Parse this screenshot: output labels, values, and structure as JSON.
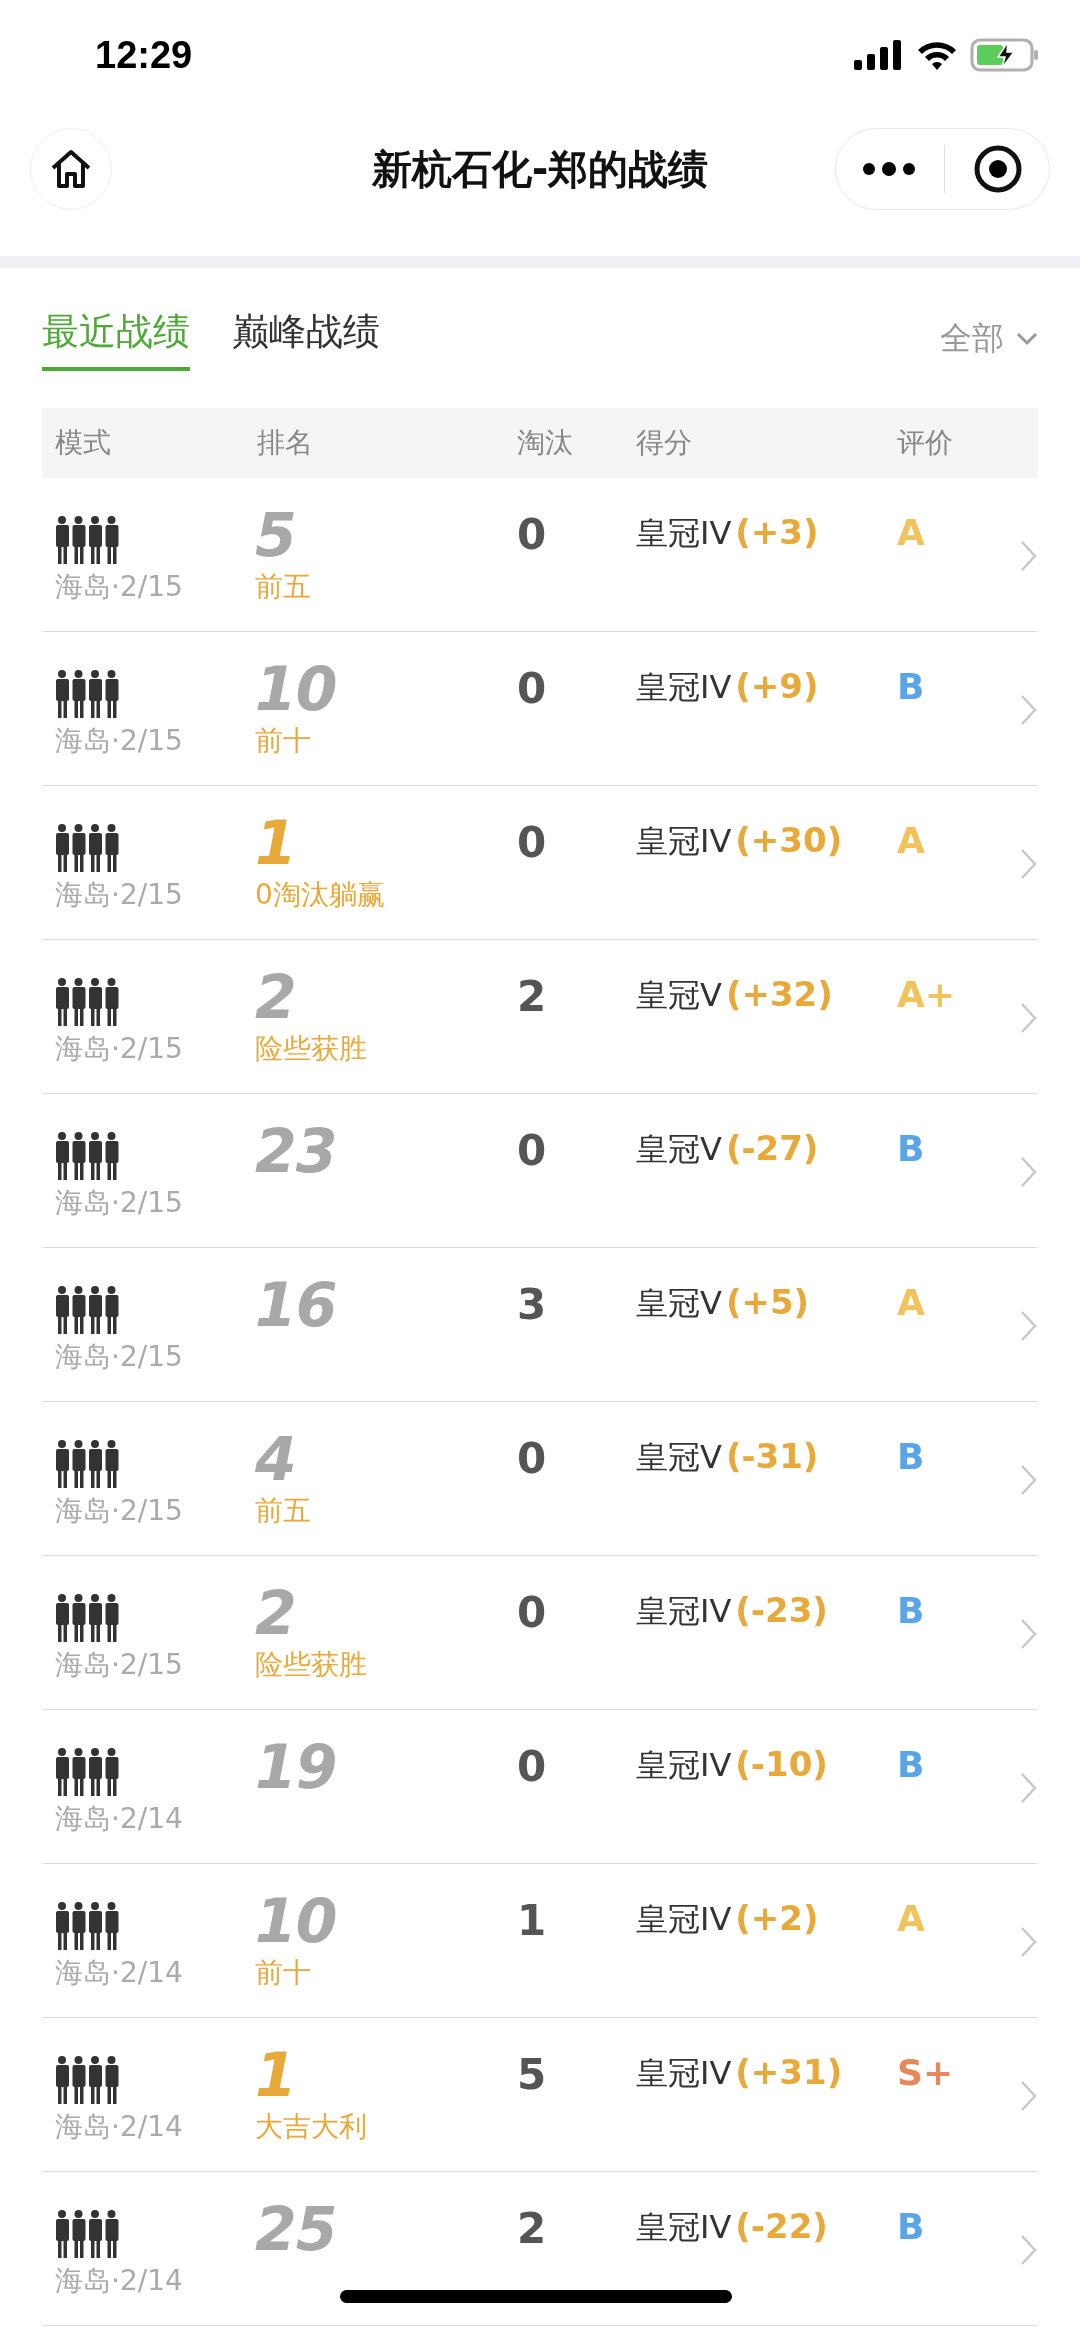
{
  "status_bar": {
    "time": "12:29"
  },
  "nav": {
    "title": "新杭石化-郑的战绩"
  },
  "tabs": [
    {
      "label": "最近战绩",
      "selected": true
    },
    {
      "label": "巅峰战绩",
      "selected": false
    }
  ],
  "filter": {
    "label": "全部"
  },
  "table": {
    "columns": [
      "模式",
      "排名",
      "淘汰",
      "得分",
      "评价"
    ],
    "rows": [
      {
        "map": "海岛·2/15",
        "rank": {
          "value": "5",
          "color": "#a8a8a8"
        },
        "rank_note": "前五",
        "eliminations": "0",
        "tier": "皇冠IV",
        "delta": "(+3)",
        "grade": {
          "value": "A",
          "color": "#f2c35b"
        }
      },
      {
        "map": "海岛·2/15",
        "rank": {
          "value": "10",
          "color": "#a8a8a8"
        },
        "rank_note": "前十",
        "eliminations": "0",
        "tier": "皇冠IV",
        "delta": "(+9)",
        "grade": {
          "value": "B",
          "color": "#5aa5e8"
        }
      },
      {
        "map": "海岛·2/15",
        "rank": {
          "value": "1",
          "color": "#e8a93a"
        },
        "rank_note": "0淘汰躺赢",
        "eliminations": "0",
        "tier": "皇冠IV",
        "delta": "(+30)",
        "grade": {
          "value": "A",
          "color": "#f2c35b"
        }
      },
      {
        "map": "海岛·2/15",
        "rank": {
          "value": "2",
          "color": "#a8a8a8"
        },
        "rank_note": "险些获胜",
        "eliminations": "2",
        "tier": "皇冠V",
        "delta": "(+32)",
        "grade": {
          "value": "A+",
          "color": "#f2c35b"
        }
      },
      {
        "map": "海岛·2/15",
        "rank": {
          "value": "23",
          "color": "#a8a8a8"
        },
        "eliminations": "0",
        "tier": "皇冠V",
        "delta": "(-27)",
        "grade": {
          "value": "B",
          "color": "#5aa5e8"
        }
      },
      {
        "map": "海岛·2/15",
        "rank": {
          "value": "16",
          "color": "#a8a8a8"
        },
        "eliminations": "3",
        "tier": "皇冠V",
        "delta": "(+5)",
        "grade": {
          "value": "A",
          "color": "#f2c35b"
        }
      },
      {
        "map": "海岛·2/15",
        "rank": {
          "value": "4",
          "color": "#a8a8a8"
        },
        "rank_note": "前五",
        "eliminations": "0",
        "tier": "皇冠V",
        "delta": "(-31)",
        "grade": {
          "value": "B",
          "color": "#5aa5e8"
        }
      },
      {
        "map": "海岛·2/15",
        "rank": {
          "value": "2",
          "color": "#a8a8a8"
        },
        "rank_note": "险些获胜",
        "eliminations": "0",
        "tier": "皇冠IV",
        "delta": "(-23)",
        "grade": {
          "value": "B",
          "color": "#5aa5e8"
        }
      },
      {
        "map": "海岛·2/14",
        "rank": {
          "value": "19",
          "color": "#a8a8a8"
        },
        "eliminations": "0",
        "tier": "皇冠IV",
        "delta": "(-10)",
        "grade": {
          "value": "B",
          "color": "#5aa5e8"
        }
      },
      {
        "map": "海岛·2/14",
        "rank": {
          "value": "10",
          "color": "#a8a8a8"
        },
        "rank_note": "前十",
        "eliminations": "1",
        "tier": "皇冠IV",
        "delta": "(+2)",
        "grade": {
          "value": "A",
          "color": "#f2c35b"
        }
      },
      {
        "map": "海岛·2/14",
        "rank": {
          "value": "1",
          "color": "#e8a93a"
        },
        "rank_note": "大吉大利",
        "eliminations": "5",
        "tier": "皇冠IV",
        "delta": "(+31)",
        "grade": {
          "value": "S+",
          "color": "#e8875a"
        }
      },
      {
        "map": "海岛·2/14",
        "rank": {
          "value": "25",
          "color": "#a8a8a8"
        },
        "eliminations": "2",
        "tier": "皇冠IV",
        "delta": "(-22)",
        "grade": {
          "value": "B",
          "color": "#5aa5e8"
        }
      }
    ]
  }
}
